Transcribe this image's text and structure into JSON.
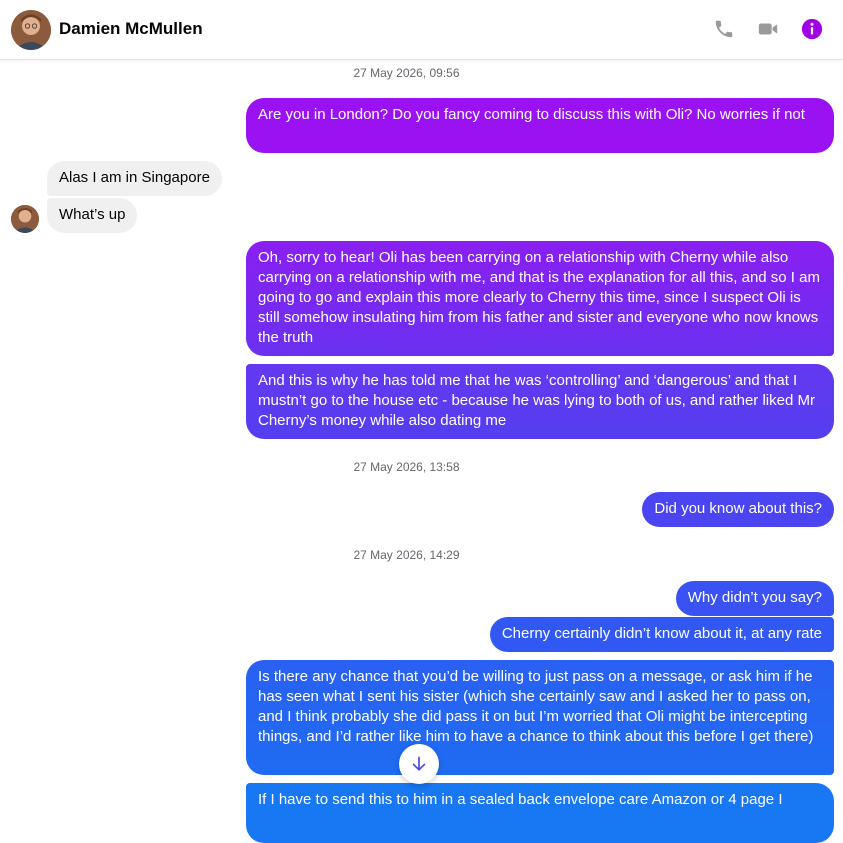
{
  "header": {
    "contact_name": "Damien McMullen",
    "icons": [
      "phone-icon",
      "video-camera-icon",
      "info-icon"
    ],
    "accent_color": "#a100e4",
    "icon_gray": "#9a9a9a"
  },
  "messages": {
    "ts1": "27 May 2026, 09:56",
    "m1": "Are you in London? Do you fancy coming to discuss this with Oli? No worries if not",
    "m2": "Alas I am in Singapore",
    "m3": "What’s up",
    "m4": "Oh, sorry to hear! Oli has been carrying on a relationship with Cherny while also carrying on a relationship with me, and that is the explanation for all this, and so I am going to go and explain this more clearly to Cherny this time, since I suspect Oli is still somehow insulating him from his father and sister and everyone who now knows the truth",
    "m5": "And this is why he has told me that he was ‘controlling’ and ‘dangerous’ and that I mustn’t go to the house etc - because he was lying to both of us, and rather liked Mr Cherny’s money while also dating me",
    "ts2": "27 May 2026, 13:58",
    "m6": "Did you know about this?",
    "ts3": "27 May 2026, 14:29",
    "m7": "Why didn’t you say?",
    "m8": "Cherny certainly didn’t know about it, at any rate",
    "m9": "Is there any chance that you’d be willing to just pass on a message, or ask him if he has seen what I sent his sister (which she certainly saw and I asked her to pass on, and I think probably she did pass it on but I’m worried that Oli might be intercepting things, and I’d rather like him to have a chance to think about this before I get there)",
    "m10": "If I have to send this to him in a sealed back envelope care Amazon or 4 page I"
  },
  "colors": {
    "gradient_top": "#9b12f2",
    "gradient_mid": "#5a3cf0",
    "gradient_bottom": "#1877f2",
    "incoming_bg": "#f0f0f0"
  }
}
